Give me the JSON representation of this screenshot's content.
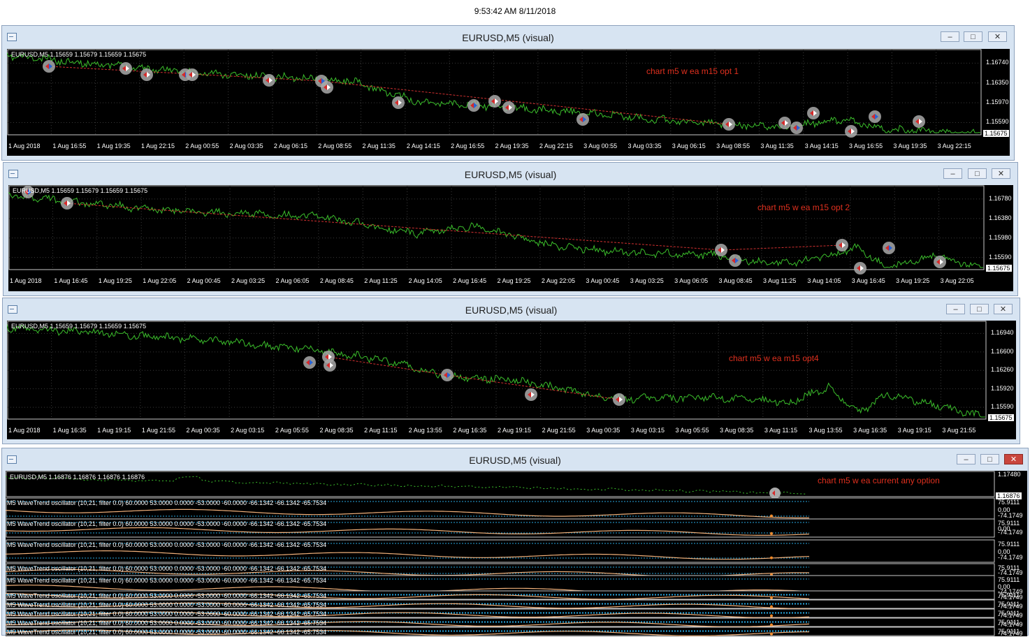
{
  "timestamp": "9:53:42 AM 8/11/2018",
  "windows": [
    {
      "title": "EURUSD,M5 (visual)",
      "symbol_line": "EURUSD,M5  1.15659 1.15679 1.15659 1.15675",
      "note": "chart m5 w ea m15 opt 1",
      "x_labels": [
        "1 Aug 2018",
        "1 Aug 16:55",
        "1 Aug 19:35",
        "1 Aug 22:15",
        "2 Aug 00:55",
        "2 Aug 03:35",
        "2 Aug 06:15",
        "2 Aug 08:55",
        "2 Aug 11:35",
        "2 Aug 14:15",
        "2 Aug 16:55",
        "2 Aug 19:35",
        "2 Aug 22:15",
        "3 Aug 00:55",
        "3 Aug 03:35",
        "3 Aug 06:15",
        "3 Aug 08:55",
        "3 Aug 11:35",
        "3 Aug 14:15",
        "3 Aug 16:55",
        "3 Aug 19:35",
        "3 Aug 22:15"
      ],
      "y_labels": [
        "1.16740",
        "1.16350",
        "1.15970",
        "1.15590"
      ],
      "current_price": "1.15675"
    },
    {
      "title": "EURUSD,M5 (visual)",
      "symbol_line": "EURUSD,M5  1.15659 1.15679 1.15659 1.15675",
      "note": "chart m5 w ea m15 opt 2",
      "x_labels": [
        "1 Aug 2018",
        "1 Aug 16:45",
        "1 Aug 19:25",
        "1 Aug 22:05",
        "2 Aug 00:45",
        "2 Aug 03:25",
        "2 Aug 06:05",
        "2 Aug 08:45",
        "2 Aug 11:25",
        "2 Aug 14:05",
        "2 Aug 16:45",
        "2 Aug 19:25",
        "2 Aug 22:05",
        "3 Aug 00:45",
        "3 Aug 03:25",
        "3 Aug 06:05",
        "3 Aug 08:45",
        "3 Aug 11:25",
        "3 Aug 14:05",
        "3 Aug 16:45",
        "3 Aug 19:25",
        "3 Aug 22:05"
      ],
      "y_labels": [
        "1.16780",
        "1.16380",
        "1.15980",
        "1.15590"
      ],
      "current_price": "1.15675"
    },
    {
      "title": "EURUSD,M5 (visual)",
      "symbol_line": "EURUSD,M5  1.15659 1.15679 1.15659 1.15675",
      "note": "chart m5 w ea m15 opt4",
      "x_labels": [
        "1 Aug 2018",
        "1 Aug 16:35",
        "1 Aug 19:15",
        "1 Aug 21:55",
        "2 Aug 00:35",
        "2 Aug 03:15",
        "2 Aug 05:55",
        "2 Aug 08:35",
        "2 Aug 11:15",
        "2 Aug 13:55",
        "2 Aug 16:35",
        "2 Aug 19:15",
        "2 Aug 21:55",
        "3 Aug 00:35",
        "3 Aug 03:15",
        "3 Aug 05:55",
        "3 Aug 08:35",
        "3 Aug 11:15",
        "3 Aug 13:55",
        "3 Aug 16:35",
        "3 Aug 19:15",
        "3 Aug 21:55"
      ],
      "y_labels": [
        "1.16940",
        "1.16600",
        "1.16260",
        "1.15920",
        "1.15590"
      ],
      "current_price": "1.15675"
    },
    {
      "title": "EURUSD,M5 (visual)",
      "symbol_line": "EURUSD,M5  1.16876 1.16876 1.16876 1.16876",
      "note": "chart m5 w ea current any option",
      "y_labels": [
        "1.17480"
      ],
      "current_price": "1.16876",
      "indicator_line": "M5 WaveTrend oscillator (10,21, filter 0.0) 60.0000 53.0000 0.0000 -53.0000 -60.0000 -66.1342 -66.1342 -65.7534",
      "indicator_y_top": "75.9111",
      "indicator_y_mid": "0.00",
      "indicator_y_bottom": "-74.1749",
      "indicator_y_small": "75.9111"
    }
  ]
}
